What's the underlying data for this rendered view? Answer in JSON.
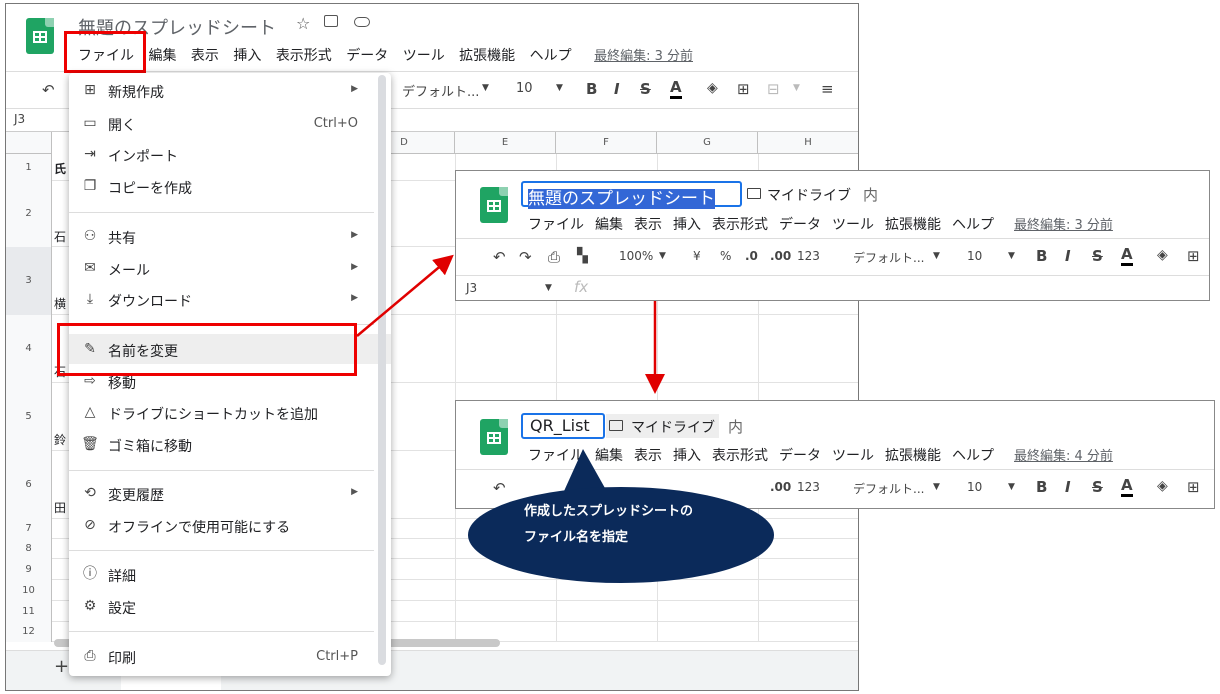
{
  "main": {
    "title": "無題のスプレッドシート",
    "menus": [
      "ファイル",
      "編集",
      "表示",
      "挿入",
      "表示形式",
      "データ",
      "ツール",
      "拡張機能",
      "ヘルプ"
    ],
    "last_edit": "最終編集: 3 分前",
    "font": "デフォルト...",
    "font_size": "10",
    "cell_ref": "J3",
    "columns": [
      "D",
      "E",
      "F",
      "G",
      "H"
    ],
    "rows": [
      "1",
      "2",
      "3",
      "4",
      "5",
      "6",
      "7",
      "8",
      "9",
      "10",
      "11",
      "12"
    ],
    "cells": [
      "氏",
      "石",
      "横",
      "石",
      "鈴",
      "田"
    ],
    "add_sheet": "+"
  },
  "file_menu": [
    {
      "label": "新規作成",
      "icon": "new-icon",
      "arrow": true
    },
    {
      "label": "開く",
      "icon": "folder-icon",
      "shortcut": "Ctrl+O"
    },
    {
      "label": "インポート",
      "icon": "import-icon"
    },
    {
      "label": "コピーを作成",
      "icon": "copy-icon"
    },
    {
      "label": "共有",
      "icon": "share-icon",
      "arrow": true
    },
    {
      "label": "メール",
      "icon": "mail-icon",
      "arrow": true
    },
    {
      "label": "ダウンロード",
      "icon": "download-icon",
      "arrow": true
    },
    {
      "label": "名前を変更",
      "icon": "rename-icon"
    },
    {
      "label": "移動",
      "icon": "move-icon"
    },
    {
      "label": "ドライブにショートカットを追加",
      "icon": "drive-shortcut-icon"
    },
    {
      "label": "ゴミ箱に移動",
      "icon": "trash-icon"
    },
    {
      "label": "変更履歴",
      "icon": "history-icon",
      "arrow": true
    },
    {
      "label": "オフラインで使用可能にする",
      "icon": "offline-icon"
    },
    {
      "label": "詳細",
      "icon": "info-icon"
    },
    {
      "label": "設定",
      "icon": "settings-icon"
    },
    {
      "label": "印刷",
      "icon": "print-icon",
      "shortcut": "Ctrl+P"
    }
  ],
  "panel1": {
    "title": "無題のスプレッドシート",
    "drive": "マイドライブ",
    "extra": "内",
    "menus": [
      "ファイル",
      "編集",
      "表示",
      "挿入",
      "表示形式",
      "データ",
      "ツール",
      "拡張機能",
      "ヘルプ"
    ],
    "last_edit": "最終編集: 3 分前",
    "zoom": "100%",
    "yen": "¥",
    "pct": "%",
    "dec1": ".0",
    "dec2": ".00",
    "num": "123",
    "font": "デフォルト...",
    "font_size": "10",
    "cell_ref": "J3",
    "fx": "fx"
  },
  "panel2": {
    "title": "QR_List",
    "drive": "マイドライブ",
    "extra": "内",
    "menus": [
      "ファイル",
      "編集",
      "表示",
      "挿入",
      "表示形式",
      "データ",
      "ツール",
      "拡張機能",
      "ヘルプ"
    ],
    "last_edit": "最終編集: 4 分前",
    "dec2": ".00",
    "num": "123",
    "font": "デフォルト...",
    "font_size": "10"
  },
  "callout": {
    "line1": "作成したスプレッドシートの",
    "line2": "ファイル名を指定"
  },
  "colors": {
    "red": "#e00000",
    "navy": "#0b2a5a",
    "sheets_green": "#1fa463",
    "selection": "#3367d6"
  }
}
